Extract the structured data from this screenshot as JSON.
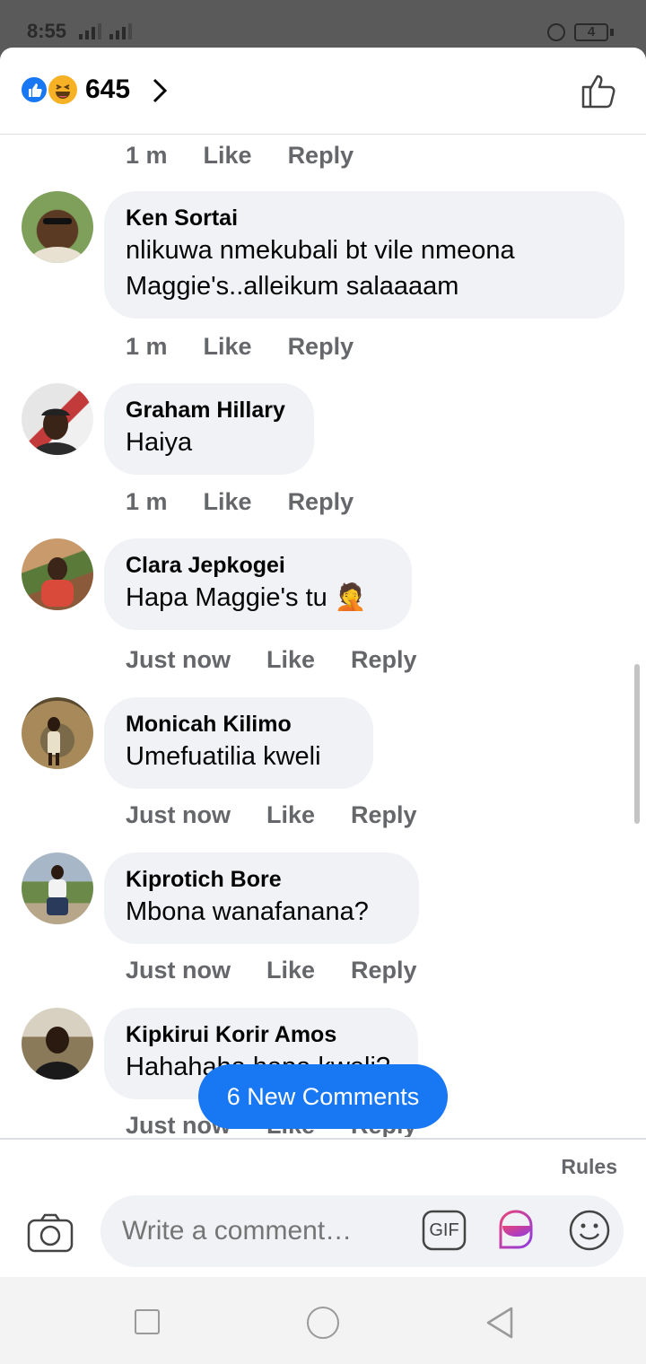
{
  "status_bar": {
    "time": "8:55",
    "battery": "4"
  },
  "reactions": {
    "count": "645"
  },
  "comments": [
    {
      "time": "1 m",
      "like": "Like",
      "reply": "Reply"
    },
    {
      "author": "Ken Sortai",
      "lines": [
        "nlikuwa nmekubali bt vile nmeona",
        "Maggie's..alleikum salaaaam"
      ],
      "time": "1 m",
      "like": "Like",
      "reply": "Reply"
    },
    {
      "author": "Graham Hillary",
      "lines": [
        "Haiya"
      ],
      "time": "1 m",
      "like": "Like",
      "reply": "Reply"
    },
    {
      "author": "Clara Jepkogei",
      "lines": [
        "Hapa Maggie's tu"
      ],
      "emoji": "🤦",
      "time": "Just now",
      "like": "Like",
      "reply": "Reply"
    },
    {
      "author": "Monicah Kilimo",
      "lines": [
        "Umefuatilia kweli"
      ],
      "time": "Just now",
      "like": "Like",
      "reply": "Reply"
    },
    {
      "author": "Kiprotich Bore",
      "lines": [
        "Mbona wanafanana?"
      ],
      "time": "Just now",
      "like": "Like",
      "reply": "Reply"
    },
    {
      "author": "Kipkirui Korir Amos",
      "lines": [
        "Hahahaha hapa kweli?"
      ],
      "time": "Just now",
      "like": "Like",
      "reply": "Reply"
    }
  ],
  "new_comments_label": "6 New Comments",
  "rules_label": "Rules",
  "composer": {
    "placeholder": "Write a comment…",
    "gif_label": "GIF"
  },
  "colors": {
    "accent": "#1877f2",
    "bubble": "#f0f2f5",
    "meta": "#65676b"
  }
}
